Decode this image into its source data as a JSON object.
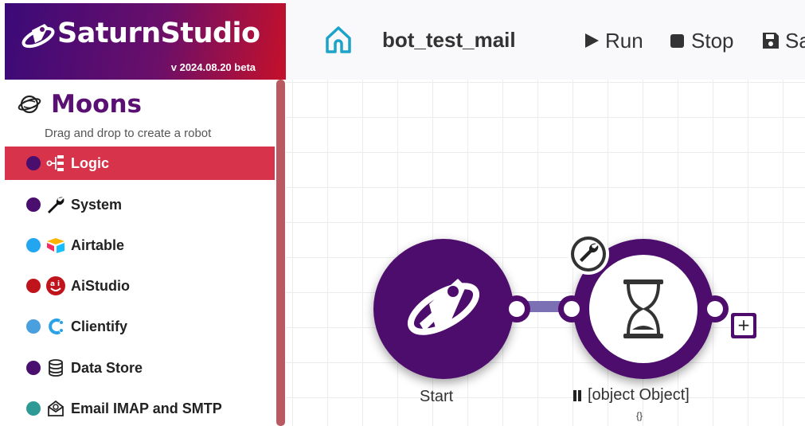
{
  "brand": {
    "name": "SaturnStudio",
    "version": "v 2024.08.20 beta"
  },
  "moons": {
    "title": "Moons",
    "subtitle": "Drag and drop to create a robot"
  },
  "categories": [
    {
      "label": "Logic",
      "dot_color": "#4a0e6e",
      "icon": "logic-tree-icon",
      "active": true
    },
    {
      "label": "System",
      "dot_color": "#4a0e6e",
      "icon": "wrench-icon",
      "active": false
    },
    {
      "label": "Airtable",
      "dot_color": "#22a6f0",
      "icon": "airtable-icon",
      "active": false
    },
    {
      "label": "AiStudio",
      "dot_color": "#c0141c",
      "icon": "aistudio-icon",
      "active": false
    },
    {
      "label": "Clientify",
      "dot_color": "#4a9fdf",
      "icon": "clientify-icon",
      "active": false
    },
    {
      "label": "Data Store",
      "dot_color": "#4a0e6e",
      "icon": "database-icon",
      "active": false
    },
    {
      "label": "Email IMAP and SMTP",
      "dot_color": "#2e9a96",
      "icon": "email-icon",
      "active": false
    }
  ],
  "topbar": {
    "home_icon": "home-icon",
    "bot_name": "bot_test_mail",
    "run_label": "Run",
    "stop_label": "Stop",
    "save_label": "Sa"
  },
  "canvas": {
    "nodes": [
      {
        "label": "Start",
        "icon": "saturn-rocket-icon"
      },
      {
        "label": "[object Object]",
        "sublabel": "{}",
        "icon": "hourglass-icon",
        "badge_icon": "wrench-icon",
        "state_icon": "pause-icon"
      }
    ],
    "add_button_label": "+"
  },
  "colors": {
    "accent_purple": "#4e0d6d",
    "active_red": "#d7334a",
    "connector": "#7b70b4"
  }
}
